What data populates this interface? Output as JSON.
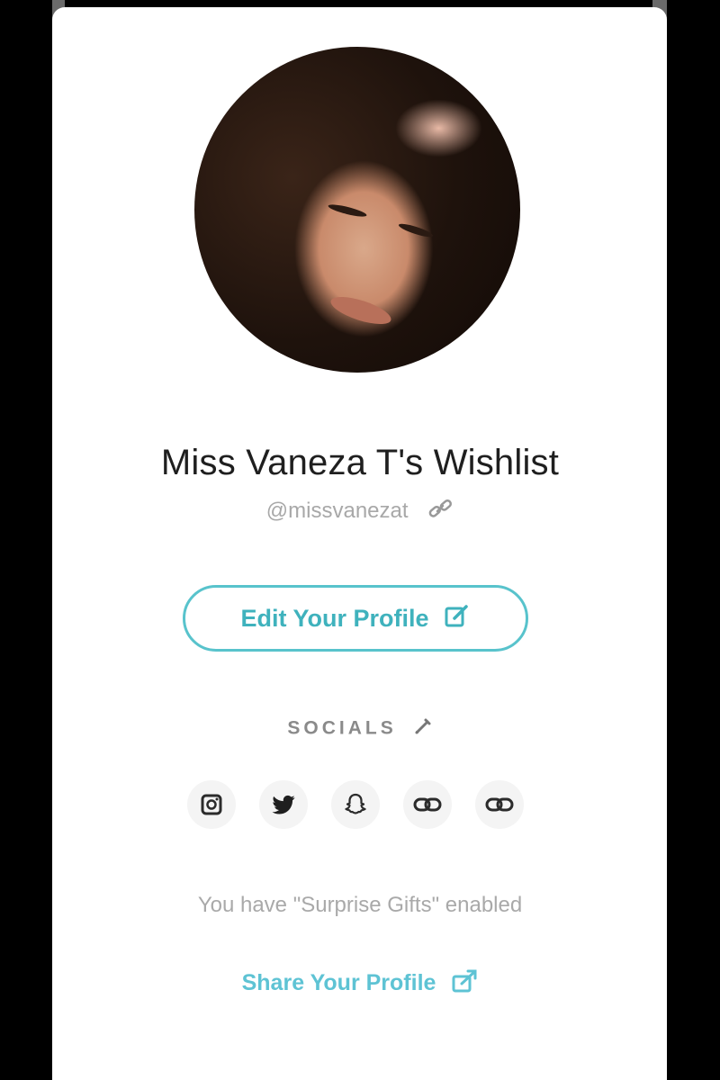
{
  "profile": {
    "title": "Miss Vaneza T's Wishlist",
    "handle": "@missvanezat"
  },
  "actions": {
    "edit_label": "Edit Your Profile",
    "share_label": "Share Your Profile"
  },
  "socials": {
    "label": "SOCIALS",
    "items": [
      {
        "icon": "instagram-icon"
      },
      {
        "icon": "twitter-icon"
      },
      {
        "icon": "snapchat-icon"
      },
      {
        "icon": "link-icon"
      },
      {
        "icon": "link-icon"
      }
    ]
  },
  "surprise_text": "You have \"Surprise Gifts\" enabled",
  "colors": {
    "accent": "#58c3cc",
    "title_text": "#1f1f1f",
    "muted_text": "#a8a8a8"
  }
}
